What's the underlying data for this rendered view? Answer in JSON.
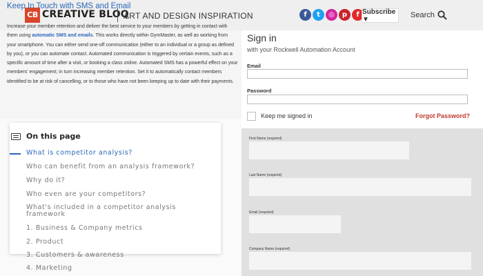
{
  "header": {
    "logo_mark": "CB",
    "logo_text": "CREATIVE BLOQ",
    "tagline": "ART AND DESIGN INSPIRATION",
    "socials": [
      {
        "name": "facebook-icon",
        "glyph": "f",
        "color": "#3b5998"
      },
      {
        "name": "twitter-icon",
        "glyph": "t",
        "color": "#1da1f2"
      },
      {
        "name": "instagram-icon",
        "glyph": "◎",
        "color": "#d6249f"
      },
      {
        "name": "pinterest-icon",
        "glyph": "p",
        "color": "#c8232c"
      },
      {
        "name": "flipboard-icon",
        "glyph": "f",
        "color": "#e12828"
      }
    ],
    "subscribe_label": "Subscribe ▼",
    "search_label": "Search"
  },
  "article": {
    "title": "Keep In Touch with SMS and Email",
    "body_before": "Increase your member retention and deliver the best service to your members by getting in contact with them using ",
    "body_link": "automatic SMS and emails",
    "body_after": ". This works directly within GymMaster, as well as working from your smartphone. You can either send one-off communication (either to an individual or a group as defined by you), or you can automate contact. Automated communication is triggered by certain events, such as a specific amount of time after a visit, or booking a class online. Automated SMS has a powerful effect on your members' engagement; in turn increasing member retention. Set it to automatically contact members identified to be at risk of cancelling, or to those who have not been keeping up to date with their payments."
  },
  "toc": {
    "heading": "On this page",
    "items": [
      "What is competitor analysis?",
      "Who can benefit from an analysis framework?",
      "Why do it?",
      "Who even are your competitors?",
      "What's included in a competitor analysis",
      "framework",
      "1. Business & Company metrics",
      "2. Product",
      "3. Customers & awareness",
      "4. Marketing"
    ]
  },
  "signin": {
    "title": "Sign in",
    "subtitle": "with your Rockwell Automation Account",
    "email_label": "Email",
    "password_label": "Password",
    "keep_label": "Keep me signed in",
    "forgot_label": "Forgot Password?"
  },
  "form": {
    "first_name_label": "First Name (required)",
    "last_name_label": "Last Name (required)",
    "email_label": "Email (required)",
    "company_label": "Company Name (required)"
  }
}
